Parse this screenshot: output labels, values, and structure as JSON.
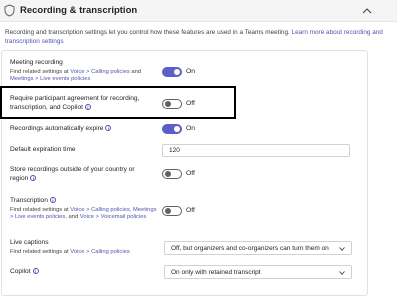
{
  "header": {
    "title": "Recording & transcription",
    "icon": "shield-icon",
    "collapse_icon": "chevron-up-icon"
  },
  "intro": {
    "text": "Recording and transcription settings let you control how these features are used in a Teams meeting.",
    "link": "Learn more about recording and transcription settings"
  },
  "settings": {
    "meeting_recording": {
      "label": "Meeting recording",
      "sub_prefix": "Find related settings at",
      "link1": "Voice > Calling policies",
      "and": "and",
      "link2": "Meetings > Live events policies",
      "state": "On"
    },
    "participant_agreement": {
      "label": "Require participant agreement for recording, transcription, and Copilot",
      "state": "Off"
    },
    "auto_expire": {
      "label": "Recordings automatically expire",
      "state": "On"
    },
    "expiration_time": {
      "label": "Default expiration time",
      "value": "120"
    },
    "store_outside": {
      "label": "Store recordings outside of your country or region",
      "state": "Off"
    },
    "transcription": {
      "label": "Transcription",
      "sub_prefix": "Find related settings at",
      "link1": "Voice > Calling policies,",
      "link2": "Meetings > Live events policies,",
      "and": "and",
      "link3": "Voice > Voicemail policies",
      "state": "Off"
    },
    "live_captions": {
      "label": "Live captions",
      "sub_prefix": "Find related settings at",
      "link1": "Voice > Calling policies",
      "value": "Off, but organizers and co-organizers can turn them on"
    },
    "copilot": {
      "label": "Copilot",
      "value": "On only with retained transcript"
    }
  },
  "colors": {
    "accent": "#5b5fc7",
    "link": "#4f52b2",
    "highlight_border": "#000000"
  }
}
